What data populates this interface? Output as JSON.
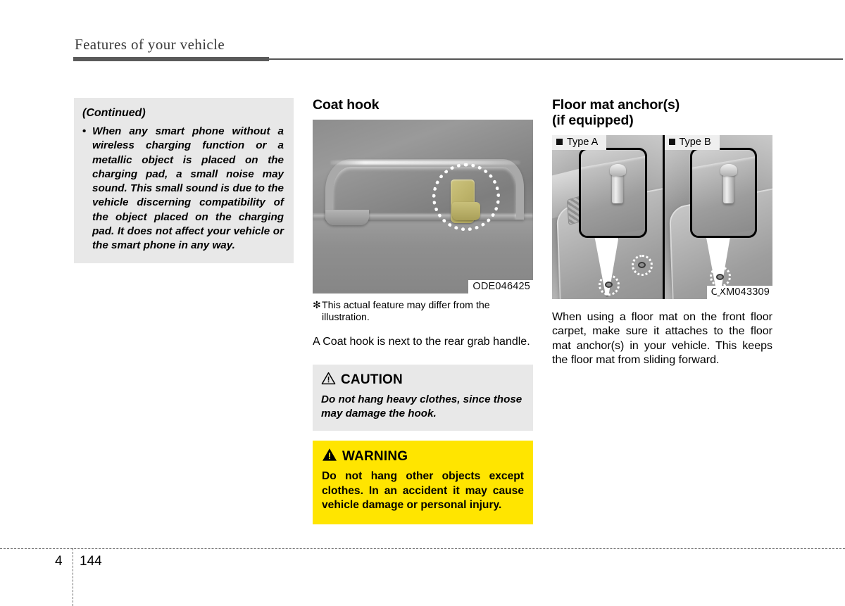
{
  "header": {
    "title": "Features of your vehicle"
  },
  "column_left": {
    "note": {
      "title": "(Continued)",
      "bullet_marker": "•",
      "text": "When any smart phone without a wireless charging function or a metallic object is placed on the charging pad, a small noise may sound. This small sound is due to the vehicle discerning compatibility of the object placed on the charging pad. It does not affect your vehicle or the smart phone in any way."
    }
  },
  "column_middle": {
    "heading": "Coat hook",
    "figure": {
      "code": "ODE046425",
      "alt": "rear grab handle with coat hook highlighted by dotted circle"
    },
    "footnote": {
      "mark": "✻",
      "text": "This actual feature may differ from the illustration."
    },
    "paragraph": "A Coat hook is next to the rear grab handle.",
    "caution": {
      "icon": "warning-triangle-outline-icon",
      "title": "CAUTION",
      "body": "Do not hang heavy clothes, since those may damage the hook."
    },
    "warning": {
      "icon": "warning-triangle-filled-icon",
      "title": "WARNING",
      "body": "Do not hang other objects except clothes. In an accident it may cause vehicle damage or personal injury.",
      "background_color": "#ffe500"
    }
  },
  "column_right": {
    "heading_line1": "Floor mat anchor(s)",
    "heading_line2": "(if equipped)",
    "figure": {
      "code": "OXM043309",
      "panels": [
        {
          "label": "Type A"
        },
        {
          "label": "Type B"
        }
      ]
    },
    "paragraph": "When using a floor mat on the front floor carpet, make sure it attaches to the floor mat anchor(s) in your vehicle. This keeps the floor mat from sliding forward."
  },
  "footer": {
    "chapter": "4",
    "page": "144"
  }
}
